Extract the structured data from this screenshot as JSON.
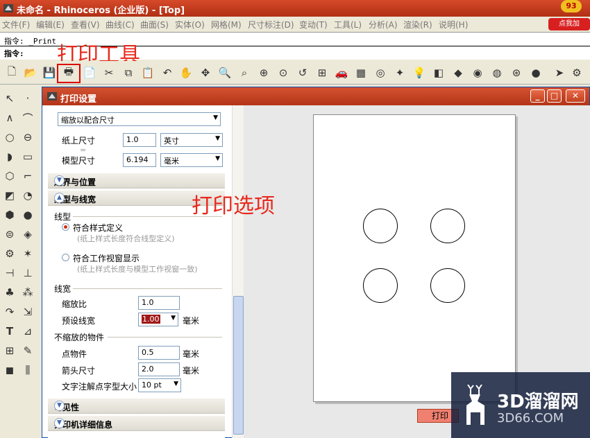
{
  "app": {
    "title": "未命名 - Rhinoceros (企业版) - [Top]",
    "badge": "93",
    "promo": "点我加"
  },
  "menubar": [
    "文件(F)",
    "编辑(E)",
    "查看(V)",
    "曲线(C)",
    "曲面(S)",
    "实体(O)",
    "网格(M)",
    "尺寸标注(D)",
    "变动(T)",
    "工具(L)",
    "分析(A)",
    "渲染(R)",
    "说明(H)"
  ],
  "command": {
    "history": "指令: _Print",
    "prompt": "指令:"
  },
  "annotations": {
    "print_tool": "打印工具",
    "print_options": "打印选项"
  },
  "toolbar": {
    "icons": [
      "new-icon",
      "open-icon",
      "save-icon",
      "print-icon",
      "page-icon",
      "cut-icon",
      "copy-icon",
      "paste-icon",
      "undo-icon",
      "pan-icon",
      "rotate-icon",
      "zoom-icon",
      "zoom-window-icon",
      "zoom-extents-icon",
      "zoom-selected-icon",
      "undo-view-icon",
      "four-viewports-icon",
      "car-icon",
      "grid-icon",
      "snap-icon",
      "osnap-icon",
      "light-icon",
      "layer-icon",
      "properties-icon",
      "color-icon",
      "sphere-icon",
      "wire-sphere-icon",
      "render-sphere-icon",
      "arrow-icon",
      "settings-icon"
    ]
  },
  "dialog": {
    "title": "打印设置",
    "scale_dropdown": "缩放以配合尺寸",
    "paper_size_label": "纸上尺寸",
    "paper_size_value": "1.0",
    "paper_unit": "英寸",
    "equals": "=",
    "model_size_label": "模型尺寸",
    "model_size_value": "6.194",
    "model_unit": "毫米",
    "sections": {
      "boundary": "边界与位置",
      "linetype_width": "线型与线宽",
      "visibility": "可见性",
      "printer_details": "打印机详细信息"
    },
    "linetype": {
      "group": "线型",
      "opt1": "符合样式定义",
      "opt1_note": "(纸上样式长度符合线型定义)",
      "opt2": "符合工作视窗显示",
      "opt2_note": "(纸上样式长度与模型工作视窗一致)",
      "selected": "符合样式定义"
    },
    "linewidth": {
      "group": "线宽",
      "scale_label": "缩放比",
      "scale_value": "1.0",
      "default_label": "预设线宽",
      "default_value": "1.00",
      "unit": "毫米"
    },
    "non_scaling": {
      "group": "不缩放的物件",
      "point_label": "点物件",
      "point_value": "0.5",
      "point_unit": "毫米",
      "arrow_label": "箭头尺寸",
      "arrow_value": "2.0",
      "arrow_unit": "毫米",
      "text_label": "文字注解点字型大小",
      "text_value": "10 pt"
    },
    "print_button": "打印"
  },
  "watermark": {
    "main": "3D溜溜网",
    "sub": "3D66.COM"
  },
  "colors": {
    "title_bar": "#c53a1c",
    "annotation": "#e8281c",
    "radio_selected": "#d02f10"
  }
}
